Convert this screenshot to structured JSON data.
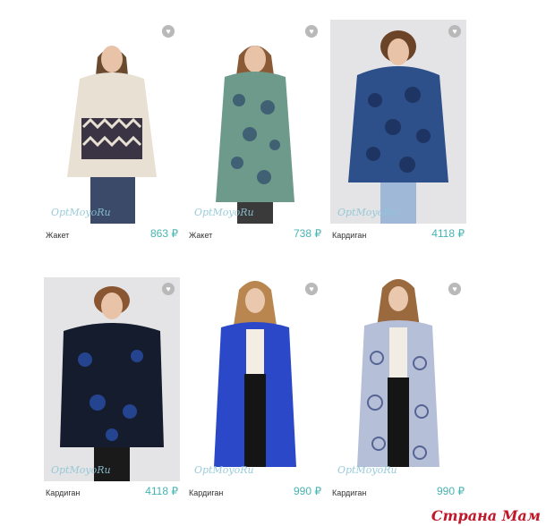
{
  "products": [
    {
      "name": "Жакет",
      "price": "863 ₽",
      "brand": "OptMoyoRu"
    },
    {
      "name": "Жакет",
      "price": "738 ₽",
      "brand": "OptMoyoRu"
    },
    {
      "name": "Кардиган",
      "price": "4118 ₽",
      "brand": "OptMoyoRu"
    },
    {
      "name": "Кардиган",
      "price": "4118 ₽",
      "brand": "OptMoyoRu"
    },
    {
      "name": "Кардиган",
      "price": "990 ₽",
      "brand": "OptMoyoRu"
    },
    {
      "name": "Кардиган",
      "price": "990 ₽",
      "brand": "OptMoyoRu"
    }
  ],
  "favorite_icon": "heart-icon",
  "watermark": "Страна Мам",
  "colors": {
    "price": "#45b5b0",
    "watermark": "#c0182a"
  }
}
